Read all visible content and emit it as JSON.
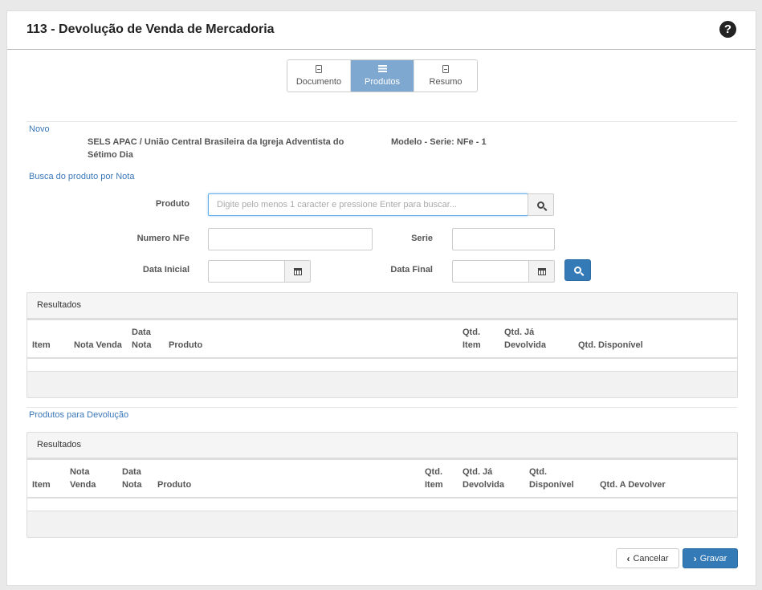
{
  "header": {
    "title": "113 - Devolução de Venda de Mercadoria",
    "help_icon": "question-circle-icon"
  },
  "wizard": {
    "tabs": [
      {
        "label": "Documento",
        "icon": "file-icon",
        "active": false
      },
      {
        "label": "Produtos",
        "icon": "list-icon",
        "active": true
      },
      {
        "label": "Resumo",
        "icon": "file-icon",
        "active": false
      }
    ]
  },
  "novo": {
    "label": "Novo",
    "entidade": "SELS APAC / União Central Brasileira da Igreja Adventista do Sétimo Dia",
    "modelo_serie": "Modelo - Serie: NFe - 1"
  },
  "busca": {
    "section_label": "Busca do produto por Nota",
    "produto_label": "Produto",
    "produto_placeholder": "Digite pelo menos 1 caracter e pressione Enter para buscar...",
    "produto_value": "",
    "numero_nfe_label": "Numero NFe",
    "numero_nfe_value": "",
    "serie_label": "Serie",
    "serie_value": "",
    "data_inicial_label": "Data Inicial",
    "data_inicial_value": "",
    "data_final_label": "Data Final",
    "data_final_value": ""
  },
  "resultados": {
    "title": "Resultados",
    "columns": [
      "Item",
      "Nota Venda",
      "Data Nota",
      "Produto",
      "Qtd. Item",
      "Qtd. Já Devolvida",
      "Qtd. Disponível"
    ]
  },
  "devolucao": {
    "section_label": "Produtos para Devolução",
    "title": "Resultados",
    "columns": [
      "Item",
      "Nota Venda",
      "Data Nota",
      "Produto",
      "Qtd. Item",
      "Qtd. Já Devolvida",
      "Qtd. Disponível",
      "Qtd. A Devolver"
    ]
  },
  "actions": {
    "cancel_label": "Cancelar",
    "save_label": "Gravar"
  },
  "colors": {
    "accent": "#337ab7",
    "active_tab": "#7fa8d1",
    "section_label": "#3a77b8"
  }
}
